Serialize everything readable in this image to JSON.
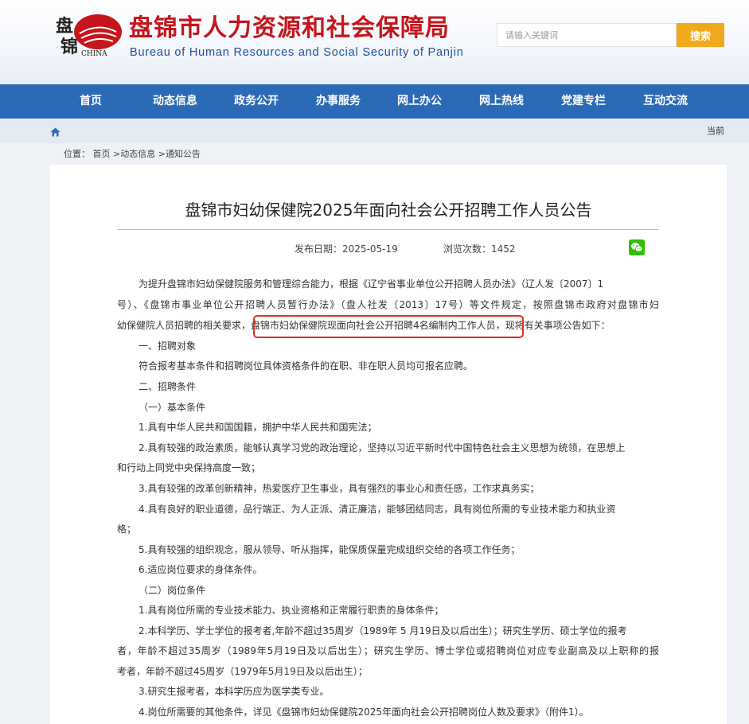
{
  "header": {
    "logo_text": "盘锦",
    "logo_sub": "CHINA",
    "title": "盘锦市人力资源和社会保障局",
    "subtitle": "Bureau of Human Resources and Social Security of Panjin",
    "search_placeholder": "请输入关键词",
    "search_button": "搜索"
  },
  "nav": {
    "items": [
      {
        "label": "首页"
      },
      {
        "label": "动态信息"
      },
      {
        "label": "政务公开"
      },
      {
        "label": "办事服务"
      },
      {
        "label": "网上办公"
      },
      {
        "label": "网上热线"
      },
      {
        "label": "党建专栏"
      },
      {
        "label": "互动交流"
      }
    ]
  },
  "crumbbar": {
    "current": "当前"
  },
  "breadcrumb": {
    "prefix": "位置：",
    "items": [
      "首页",
      "动态信息",
      "通知公告"
    ],
    "sep": ">"
  },
  "article": {
    "title": "盘锦市妇幼保健院2025年面向社会公开招聘工作人员公告",
    "date_label": "发布日期：",
    "date": "2025-05-19",
    "views_label": "浏览次数：",
    "views": "1452",
    "lines": [
      "为提升盘锦市妇幼保健院服务和管理综合能力，根据《辽宁省事业单位公开招聘人员办法》（辽人发〔2007〕1",
      "号）、《盘锦市事业单位公开招聘人员暂行办法》（盘人社发〔2013〕17号）等文件规定，按照盘锦市政府对盘锦市妇",
      "幼保健院人员招聘的相关要求，盘锦市妇幼保健院现面向社会公开招聘4名编制内工作人员，现将有关事项公告如下：",
      "一、招聘对象",
      "符合报考基本条件和招聘岗位具体资格条件的在职、非在职人员均可报名应聘。",
      "二、招聘条件",
      "（一）基本条件",
      "1.具有中华人民共和国国籍，拥护中华人民共和国宪法；",
      "2.具有较强的政治素质，能够认真学习党的政治理论，坚持以习近平新时代中国特色社会主义思想为统领，在思想上",
      "和行动上同党中央保持高度一致；",
      "3.具有较强的改革创新精神，热爱医疗卫生事业，具有强烈的事业心和责任感，工作求真务实；",
      "4.具有良好的职业道德，品行端正、为人正派、清正廉洁，能够团结同志，具有岗位所需的专业技术能力和执业资",
      "格；",
      "5.具有较强的组织观念，服从领导、听从指挥，能保质保量完成组织交给的各项工作任务；",
      "6.适应岗位要求的身体条件。",
      "（二）岗位条件",
      "1.具有岗位所需的专业技术能力、执业资格和正常履行职责的身体条件；",
      "2.本科学历、学士学位的报考者,年龄不超过35周岁（1989年 5 月19日及以后出生）；研究生学历、硕士学位的报考",
      "者，年龄不超过35周岁（1989年5月19日及以后出生）；研究生学历、博士学位或招聘岗位对应专业副高及以上职称的报",
      "考者，年龄不超过45周岁（1979年5月19日及以后出生）；",
      "3.研究生报考者，本科学历应为医学类专业。",
      "4.岗位所需要的其他条件，详见《盘锦市妇幼保健院2025年面向社会公开招聘岗位人数及要求》（附件1）。"
    ]
  },
  "colors": {
    "brand_red": "#c4161c",
    "nav_blue": "#2a6ab6",
    "search_orange": "#f0a91a",
    "highlight_red": "#e0321c",
    "wechat_green": "#2dc100"
  }
}
